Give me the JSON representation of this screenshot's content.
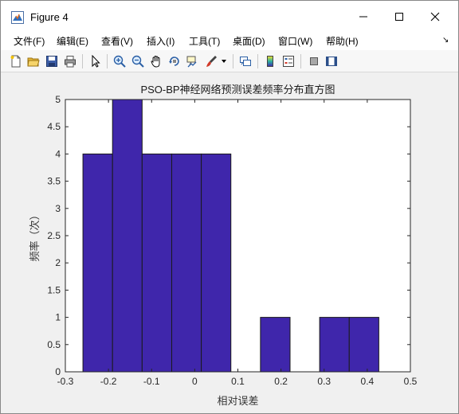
{
  "window": {
    "title": "Figure 4",
    "controls": {
      "minimize": "minimize",
      "maximize": "maximize",
      "close": "close"
    }
  },
  "menu": [
    {
      "id": "file",
      "label": "文件(F)"
    },
    {
      "id": "edit",
      "label": "编辑(E)"
    },
    {
      "id": "view",
      "label": "查看(V)"
    },
    {
      "id": "insert",
      "label": "插入(I)"
    },
    {
      "id": "tools",
      "label": "工具(T)"
    },
    {
      "id": "desktop",
      "label": "桌面(D)"
    },
    {
      "id": "window",
      "label": "窗口(W)"
    },
    {
      "id": "help",
      "label": "帮助(H)"
    }
  ],
  "toolbar": {
    "icons": [
      "new-figure-icon",
      "open-file-icon",
      "save-icon",
      "print-icon",
      "select-arrow-icon",
      "zoom-in-icon",
      "zoom-out-icon",
      "pan-hand-icon",
      "rotate-3d-icon",
      "data-cursor-icon",
      "brush-icon",
      "brush-dropdown-icon",
      "link-plot-icon",
      "colorbar-icon",
      "legend-icon",
      "hide-plot-tools-icon",
      "show-plot-tools-icon"
    ]
  },
  "chart_data": {
    "type": "bar",
    "title": "PSO-BP神经网络预测误差频率分布直方图",
    "xlabel": "相对误差",
    "ylabel": "频率（次）",
    "bin_edges": [
      -0.2592,
      -0.1906,
      -0.122,
      -0.0534,
      0.0152,
      0.0838,
      0.1524,
      0.221,
      0.2896,
      0.3582,
      0.4268
    ],
    "values": [
      4,
      5,
      4,
      4,
      4,
      0,
      1,
      0,
      1,
      1
    ],
    "xlim": [
      -0.3,
      0.5
    ],
    "ylim": [
      0,
      5
    ],
    "xticks": [
      -0.3,
      -0.2,
      -0.1,
      0,
      0.1,
      0.2,
      0.3,
      0.4,
      0.5
    ],
    "xtick_labels": [
      "-0.3",
      "-0.2",
      "-0.1",
      "0",
      "0.1",
      "0.2",
      "0.3",
      "0.4",
      "0.5"
    ],
    "yticks": [
      0,
      0.5,
      1,
      1.5,
      2,
      2.5,
      3,
      3.5,
      4,
      4.5,
      5
    ],
    "ytick_labels": [
      "0",
      "0.5",
      "1",
      "1.5",
      "2",
      "2.5",
      "3",
      "3.5",
      "4",
      "4.5",
      "5"
    ],
    "bar_color": "#3f26ab",
    "edge_color": "#1a1a1a",
    "grid": false
  }
}
